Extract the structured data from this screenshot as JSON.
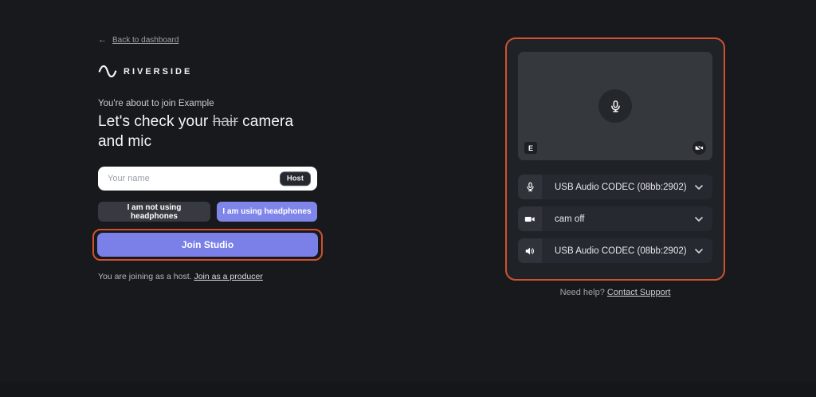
{
  "colors": {
    "accent_purple": "#8086e9",
    "join_button_purple": "#7a80e7",
    "annotation_orange": "#d0512f",
    "page_background": "#17191d"
  },
  "header": {
    "back_arrow_icon": "←",
    "back_link": "Back to dashboard",
    "brand": "RIVERSIDE"
  },
  "join_form": {
    "subtitle": "You're about to join Example",
    "heading_before": "Let's check your",
    "heading_strikethrough": "hair",
    "heading_after": "camera and mic",
    "name_placeholder": "Your name",
    "role_badge": "Host",
    "headphones_off_label": "I am not using headphones",
    "headphones_on_label": "I am using headphones",
    "join_button_label": "Join Studio",
    "footnote_text": "You are joining as a host.",
    "footnote_link": "Join as a producer"
  },
  "device_panel": {
    "preview_initial": "E",
    "selects": [
      {
        "icon": "microphone-icon",
        "label": "USB Audio CODEC (08bb:2902)"
      },
      {
        "icon": "camera-icon",
        "label": "cam off"
      },
      {
        "icon": "speaker-icon",
        "label": "USB Audio CODEC (08bb:2902)"
      }
    ]
  },
  "help": {
    "text": "Need help?",
    "link": "Contact Support"
  }
}
